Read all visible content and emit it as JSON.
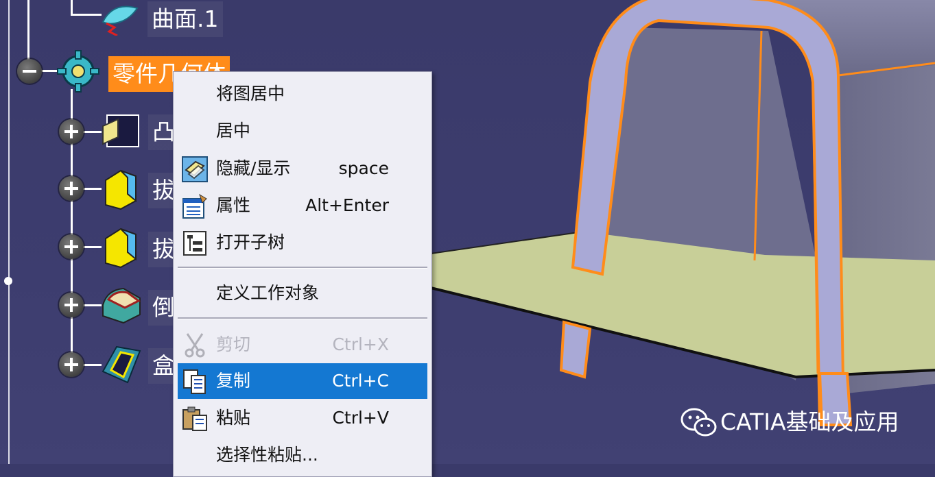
{
  "tree": {
    "nodes": [
      {
        "label": "曲面.1"
      },
      {
        "label": "零件几何体"
      },
      {
        "label": "凸"
      },
      {
        "label": "拔"
      },
      {
        "label": "拔"
      },
      {
        "label": "倒"
      },
      {
        "label": "盒"
      }
    ]
  },
  "context_menu": {
    "items": [
      {
        "label": "将图居中",
        "shortcut": ""
      },
      {
        "label": "居中",
        "shortcut": ""
      },
      {
        "label": "隐藏/显示",
        "shortcut": "space",
        "icon": "hide-show-icon"
      },
      {
        "label": "属性",
        "shortcut": "Alt+Enter",
        "icon": "properties-icon"
      },
      {
        "label": "打开子树",
        "shortcut": "",
        "icon": "open-subtree-icon"
      },
      {
        "label": "定义工作对象",
        "shortcut": ""
      },
      {
        "label": "剪切",
        "shortcut": "Ctrl+X",
        "icon": "scissors-icon",
        "disabled": true
      },
      {
        "label": "复制",
        "shortcut": "Ctrl+C",
        "icon": "copy-icon",
        "highlighted": true
      },
      {
        "label": "粘贴",
        "shortcut": "Ctrl+V",
        "icon": "paste-icon"
      },
      {
        "label": "选择性粘贴...",
        "shortcut": ""
      }
    ]
  },
  "watermark": {
    "text": "CATIA基础及应用",
    "icon": "wechat-icon"
  },
  "colors": {
    "background": "#3d3d6f",
    "selection": "#ff8c1a",
    "menu_highlight": "#1478d2",
    "model_edge": "#ff8c1a",
    "model_face": "#a8a8d0",
    "plane": "#c8cf98"
  }
}
